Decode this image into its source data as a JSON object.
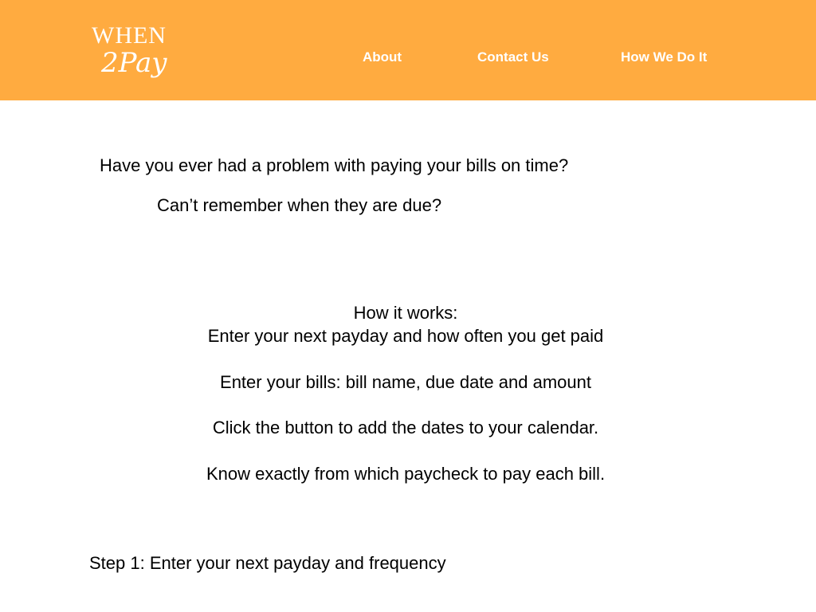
{
  "header": {
    "logo": {
      "line1": "WHEN",
      "line2": "2Pay"
    },
    "nav": [
      {
        "label": "About"
      },
      {
        "label": "Contact Us"
      },
      {
        "label": "How We Do It"
      }
    ],
    "colors": {
      "background": "#ffab40",
      "text": "#ffffff"
    }
  },
  "intro": {
    "question1": "Have you ever had a problem with paying your bills on time?",
    "question2": "Can’t remember when they are due?"
  },
  "how_it_works": {
    "title": "How it works:",
    "steps": [
      "Enter your next payday and how often you get paid",
      "Enter your bills: bill name, due date and amount",
      "Click the button to add the dates to your calendar.",
      "Know exactly from which paycheck to pay each bill."
    ]
  },
  "step1": {
    "label": "Step 1: Enter your next payday and frequency"
  }
}
